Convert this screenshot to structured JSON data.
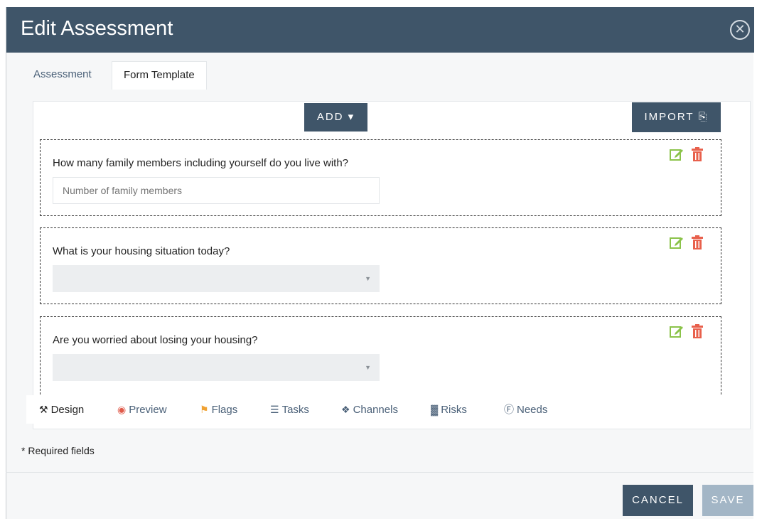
{
  "header": {
    "title": "Edit Assessment",
    "close_icon": "close-circle-icon"
  },
  "tabs": [
    {
      "label": "Assessment",
      "active": false
    },
    {
      "label": "Form Template",
      "active": true
    }
  ],
  "toolbar": {
    "add_label": "ADD ▾",
    "import_label": "IMPORT ⎘"
  },
  "questions": [
    {
      "text": "How many family members including yourself do you live with?",
      "type": "text",
      "placeholder": "Number of family members"
    },
    {
      "text": "What is your housing situation today?",
      "type": "select",
      "value": ""
    },
    {
      "text": "Are you worried about losing your housing?",
      "type": "select",
      "value": ""
    }
  ],
  "bottom_tabs": [
    {
      "label": "Design",
      "icon": "tools-icon",
      "glyph": "⚒"
    },
    {
      "label": "Preview",
      "icon": "eye-icon",
      "glyph": "◉"
    },
    {
      "label": "Flags",
      "icon": "flag-icon",
      "glyph": "⚑"
    },
    {
      "label": "Tasks",
      "icon": "list-icon",
      "glyph": "☰"
    },
    {
      "label": "Channels",
      "icon": "cubes-icon",
      "glyph": "❖"
    },
    {
      "label": "Risks",
      "icon": "chart-icon",
      "glyph": "▓"
    },
    {
      "label": "Needs",
      "icon": "accessibility-icon",
      "glyph": "Ⓕ"
    }
  ],
  "footer": {
    "required_note": "* Required fields",
    "cancel_label": "CANCEL",
    "save_label": "SAVE"
  },
  "colors": {
    "header_bg": "#3f5569",
    "primary_button": "#3f5569",
    "disabled_button": "#a3b6c6",
    "edit_icon": "#8bc34a",
    "trash_icon": "#e8604c",
    "preview_icon": "#e05a4a",
    "flags_icon": "#f0a233"
  }
}
